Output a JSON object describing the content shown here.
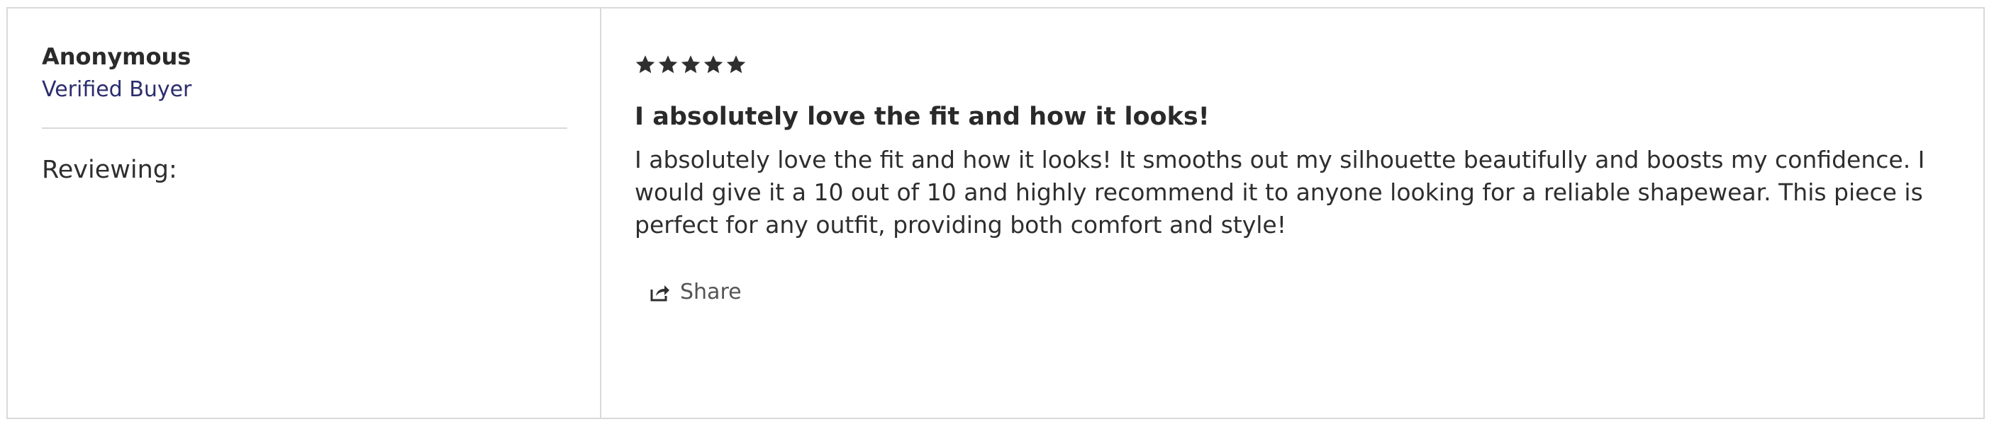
{
  "reviewer": {
    "name": "Anonymous",
    "badge": "Verified Buyer",
    "reviewing_label": "Reviewing:"
  },
  "review": {
    "rating": 5,
    "rating_max": 5,
    "title": "I absolutely love the fit and how it looks!",
    "body": "I absolutely love the fit and how it looks! It smooths out my silhouette beautifully and boosts my confidence. I would give it a 10 out of 10 and highly recommend it to anyone looking for a reliable shapewear. This piece is perfect for any outfit, providing both comfort and style!"
  },
  "actions": {
    "share_label": "Share",
    "share_icon": "share-icon"
  },
  "colors": {
    "text": "#2c2c2c",
    "badge": "#2b2d6e",
    "border": "#d9d9d9",
    "star": "#2f2f2f"
  }
}
